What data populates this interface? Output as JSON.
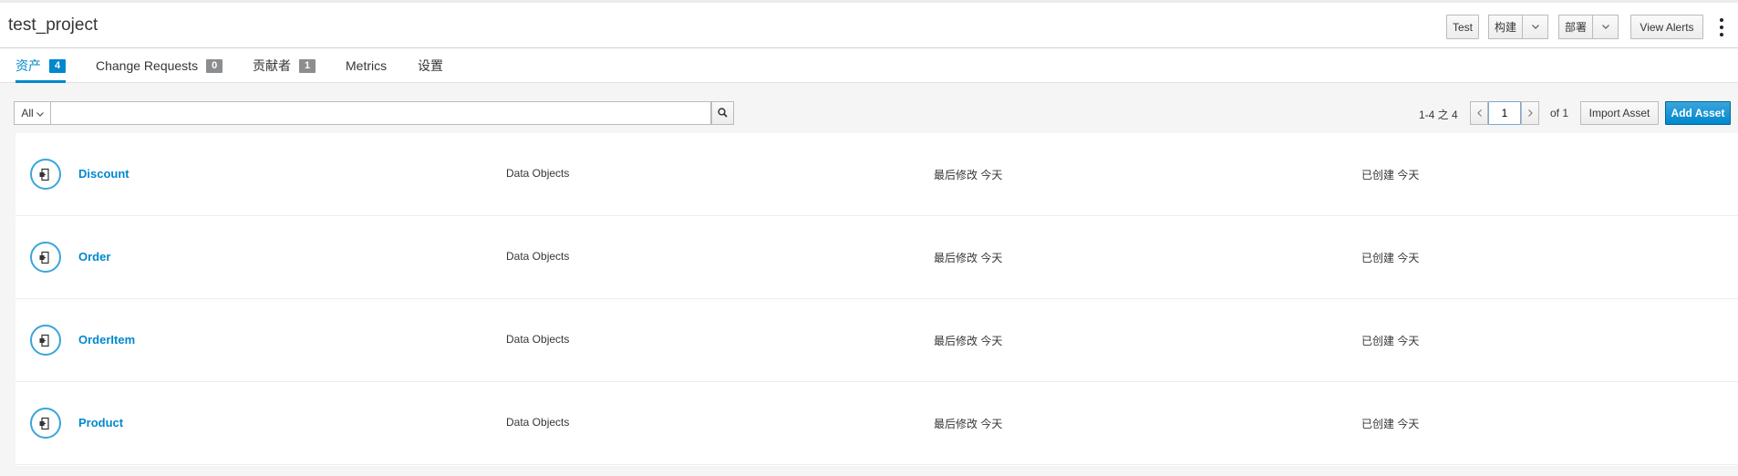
{
  "header": {
    "project_title": "test_project",
    "test_label": "Test",
    "build_label": "构建",
    "deploy_label": "部署",
    "view_alerts_label": "View Alerts"
  },
  "tabs": [
    {
      "label": "资产",
      "count": "4",
      "active": true
    },
    {
      "label": "Change Requests",
      "count": "0"
    },
    {
      "label": "贡献者",
      "count": "1"
    },
    {
      "label": "Metrics"
    },
    {
      "label": "设置"
    }
  ],
  "toolbar": {
    "filter_value": "All",
    "search_value": "",
    "range_text": "1-4 之 4",
    "page_value": "1",
    "of_text": "of 1",
    "import_label": "Import Asset",
    "add_label": "Add Asset"
  },
  "assets": [
    {
      "name": "Discount",
      "type": "Data Objects",
      "modified": "最后修改 今天",
      "created": "已创建 今天"
    },
    {
      "name": "Order",
      "type": "Data Objects",
      "modified": "最后修改 今天",
      "created": "已创建 今天"
    },
    {
      "name": "OrderItem",
      "type": "Data Objects",
      "modified": "最后修改 今天",
      "created": "已创建 今天"
    },
    {
      "name": "Product",
      "type": "Data Objects",
      "modified": "最后修改 今天",
      "created": "已创建 今天"
    }
  ],
  "icons": {
    "asset": "data-object-icon",
    "search": "search-icon",
    "kebab": "kebab-menu-icon"
  },
  "colors": {
    "accent": "#0088ce",
    "badge": "#8b8d8f"
  }
}
